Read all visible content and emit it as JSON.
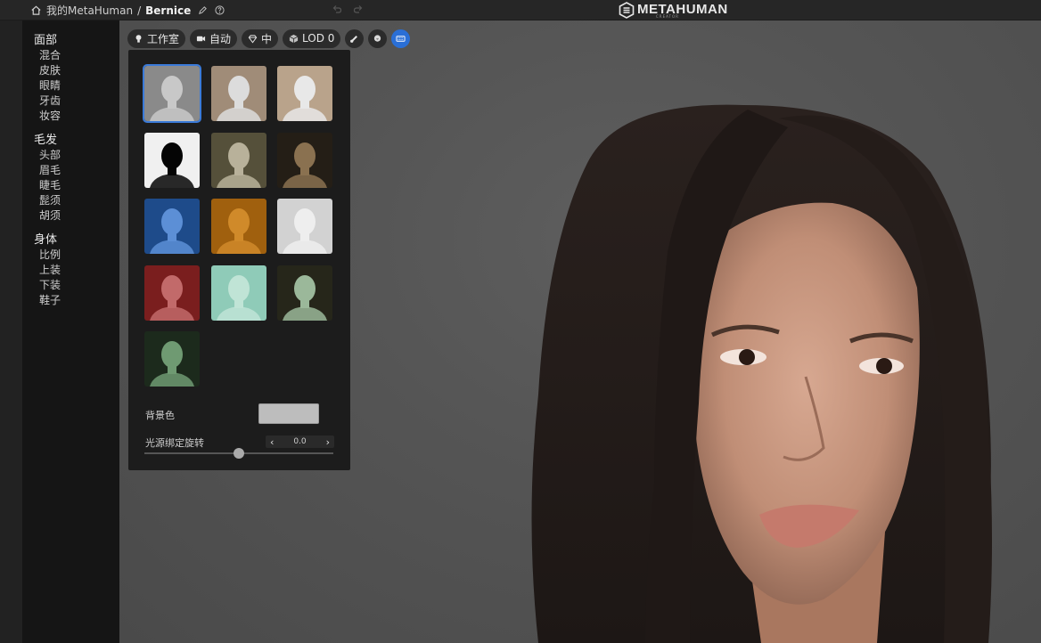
{
  "header": {
    "breadcrumb_root": "我的MetaHuman",
    "breadcrumb_sep": "/",
    "breadcrumb_current": "Bernice",
    "logo_text": "METAHUMAN",
    "logo_sub": "CREATOR"
  },
  "sidebar": {
    "sections": [
      {
        "title": "面部",
        "items": [
          "混合",
          "皮肤",
          "眼睛",
          "牙齿",
          "妆容"
        ]
      },
      {
        "title": "毛发",
        "items": [
          "头部",
          "眉毛",
          "睫毛",
          "髭须",
          "胡须"
        ]
      },
      {
        "title": "身体",
        "items": [
          "比例",
          "上装",
          "下装",
          "鞋子"
        ]
      }
    ]
  },
  "toolbar": {
    "lighting_label": "工作室",
    "camera_label": "自动",
    "quality_label": "中",
    "lod_label": "LOD 0",
    "active_color": "#2a6fd6"
  },
  "lighting_panel": {
    "presets": [
      {
        "name": "studio",
        "bg": "#8a8a8a",
        "face": "#c8c8c8",
        "selected": true
      },
      {
        "name": "warm-gray",
        "bg": "#a08c78",
        "face": "#dcdcdc",
        "selected": false
      },
      {
        "name": "outdoor",
        "bg": "#b9a38b",
        "face": "#e8e8e8",
        "selected": false
      },
      {
        "name": "silhouette",
        "bg": "#f0f0f0",
        "face": "#050505",
        "selected": false
      },
      {
        "name": "olive",
        "bg": "#55503a",
        "face": "#b8b19a",
        "selected": false
      },
      {
        "name": "low-key",
        "bg": "#241e16",
        "face": "#8a7150",
        "selected": false
      },
      {
        "name": "blue",
        "bg": "#1e4b8a",
        "face": "#5c8fd6",
        "selected": false
      },
      {
        "name": "amber",
        "bg": "#a0600e",
        "face": "#d08a2a",
        "selected": false
      },
      {
        "name": "high-key",
        "bg": "#d2d2d2",
        "face": "#eeeeee",
        "selected": false
      },
      {
        "name": "red-rim",
        "bg": "#7a1e1e",
        "face": "#c26a6a",
        "selected": false
      },
      {
        "name": "mint",
        "bg": "#8fcbb8",
        "face": "#c0e4d6",
        "selected": false
      },
      {
        "name": "bokeh",
        "bg": "#26261a",
        "face": "#9bb89a",
        "selected": false
      },
      {
        "name": "green-night",
        "bg": "#1c2a1c",
        "face": "#6f9a72",
        "selected": false
      }
    ],
    "bg_color_label": "背景色",
    "bg_color_value": "#bdbdbd",
    "light_rotation_label": "光源绑定旋转",
    "light_rotation_value": "0.0",
    "light_rotation_fraction": 0.5
  }
}
